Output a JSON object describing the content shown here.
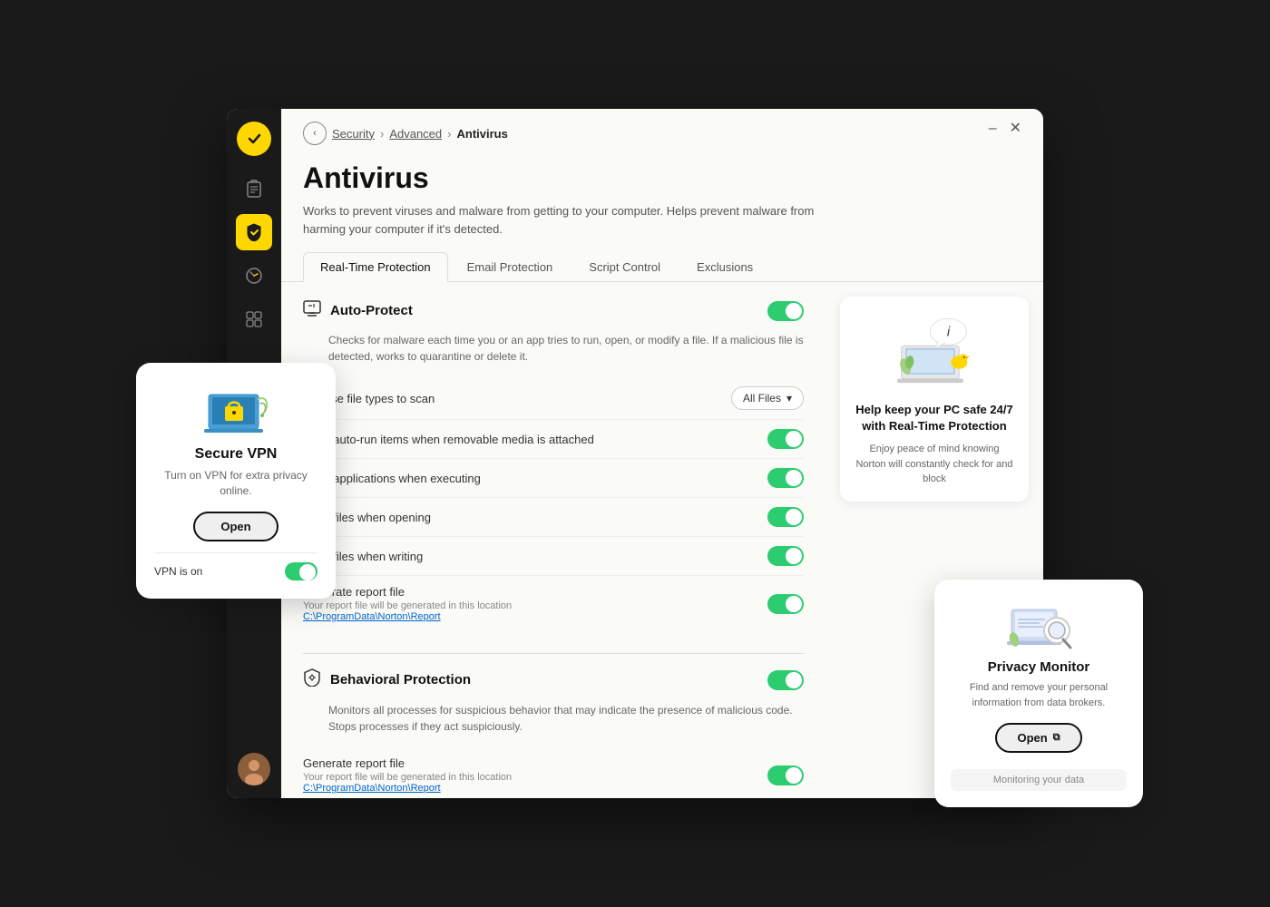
{
  "window": {
    "title": "Antivirus",
    "minimize_label": "–",
    "close_label": "✕"
  },
  "breadcrumb": {
    "back_label": "‹",
    "security": "Security",
    "advanced": "Advanced",
    "current": "Antivirus",
    "sep": "›"
  },
  "page": {
    "title": "Antivirus",
    "description": "Works to prevent viruses and malware from getting to your computer. Helps prevent malware from harming your computer if it's detected."
  },
  "tabs": [
    {
      "id": "realtime",
      "label": "Real-Time Protection",
      "active": true
    },
    {
      "id": "email",
      "label": "Email Protection",
      "active": false
    },
    {
      "id": "script",
      "label": "Script Control",
      "active": false
    },
    {
      "id": "exclusions",
      "label": "Exclusions",
      "active": false
    }
  ],
  "sections": [
    {
      "id": "auto-protect",
      "icon": "🖥",
      "title": "Auto-Protect",
      "description": "Checks for malware each time you or an app tries to run, open, or modify a file. If a malicious file is detected, works to quarantine or delete it.",
      "toggled": true,
      "settings": [
        {
          "id": "file-types",
          "label": "Choose file types to scan",
          "type": "dropdown",
          "value": "All Files"
        },
        {
          "id": "autorun",
          "label": "Scan auto-run items when removable media is attached",
          "type": "toggle",
          "enabled": true
        },
        {
          "id": "apps-executing",
          "label": "Scan applications when executing",
          "type": "toggle",
          "enabled": true
        },
        {
          "id": "files-opening",
          "label": "Scan files when opening",
          "type": "toggle",
          "enabled": true
        },
        {
          "id": "files-writing",
          "label": "Scan files when writing",
          "type": "toggle",
          "enabled": true
        },
        {
          "id": "report-file",
          "label": "Generate report file",
          "sublabel": "Your report file will be generated in this location",
          "link": "C:\\ProgramData\\Norton\\Report",
          "type": "toggle",
          "enabled": true
        }
      ]
    },
    {
      "id": "behavioral",
      "icon": "🛡",
      "title": "Behavioral Protection",
      "description": "Monitors all processes for suspicious behavior that may indicate the presence of malicious code. Stops processes if they act suspiciously.",
      "toggled": true,
      "settings": [
        {
          "id": "behav-report",
          "label": "Generate report file",
          "sublabel": "Your report file will be generated in this location",
          "link": "C:\\ProgramData\\Norton\\Report",
          "type": "toggle",
          "enabled": true
        }
      ]
    }
  ],
  "sidebar": {
    "icons": [
      {
        "id": "checkmark",
        "symbol": "✓",
        "active": false,
        "label": "norton-logo"
      },
      {
        "id": "clipboard",
        "symbol": "📋",
        "active": false,
        "label": "clipboard-icon"
      },
      {
        "id": "shield",
        "symbol": "🛡",
        "active": true,
        "label": "shield-icon"
      },
      {
        "id": "speed",
        "symbol": "⏱",
        "active": false,
        "label": "performance-icon"
      },
      {
        "id": "apps",
        "symbol": "⊞",
        "active": false,
        "label": "apps-icon"
      }
    ],
    "avatar_label": "user-avatar"
  },
  "vpn_popup": {
    "title": "Secure VPN",
    "description": "Turn on VPN for extra privacy online.",
    "open_label": "Open",
    "status": "VPN is on"
  },
  "privacy_popup": {
    "title": "Privacy Monitor",
    "description": "Find and remove your personal information from data brokers.",
    "open_label": "Open",
    "open_icon": "⧉",
    "status": "Monitoring your data"
  },
  "promo_card": {
    "title": "Help keep your PC safe 24/7 with Real-Time Protection",
    "description": "Enjoy peace of mind knowing Norton will constantly check for and block"
  },
  "colors": {
    "toggle_on": "#2ecc71",
    "accent_yellow": "#ffd700",
    "brand_dark": "#1a1a1a"
  }
}
